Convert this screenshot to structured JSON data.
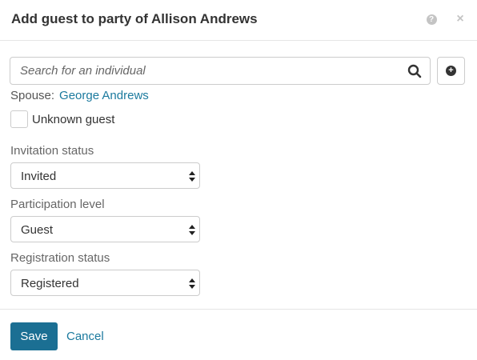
{
  "dialog": {
    "title": "Add guest to party of Allison Andrews",
    "help_icon": "question-circle-icon",
    "close_icon": "close-icon"
  },
  "search": {
    "placeholder": "Search for an individual",
    "value": "",
    "search_icon": "magnifier-icon",
    "add_icon": "plus-circle-icon"
  },
  "spouse": {
    "label": "Spouse:",
    "name": "George Andrews"
  },
  "unknown_guest": {
    "label": "Unknown guest",
    "checked": false
  },
  "fields": {
    "invitation": {
      "label": "Invitation status",
      "value": "Invited"
    },
    "participation": {
      "label": "Participation level",
      "value": "Guest"
    },
    "registration": {
      "label": "Registration status",
      "value": "Registered"
    }
  },
  "footer": {
    "save_label": "Save",
    "cancel_label": "Cancel"
  },
  "colors": {
    "accent": "#1b6f93",
    "link": "#1b7a9e",
    "border": "#cccccc"
  }
}
